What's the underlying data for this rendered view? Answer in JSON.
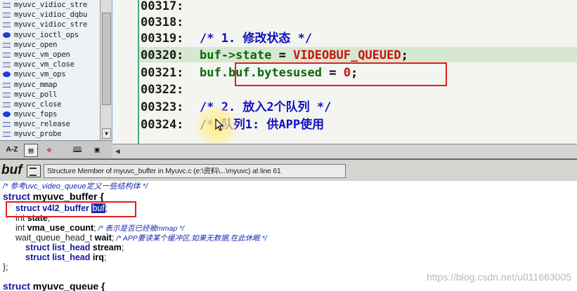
{
  "symbol_list": {
    "items": [
      {
        "label": "myuvc_vidioc_stre",
        "icon": "line"
      },
      {
        "label": "myuvc_vidioc_dqbu",
        "icon": "line"
      },
      {
        "label": "myuvc_vidioc_stre",
        "icon": "line"
      },
      {
        "label": "myuvc_ioctl_ops",
        "icon": "blob"
      },
      {
        "label": "myuvc_open",
        "icon": "line"
      },
      {
        "label": "myuvc_vm_open",
        "icon": "line"
      },
      {
        "label": "myuvc_vm_close",
        "icon": "line"
      },
      {
        "label": "myuvc_vm_ops",
        "icon": "blob"
      },
      {
        "label": "myuvc_mmap",
        "icon": "line"
      },
      {
        "label": "myuvc_poll",
        "icon": "line"
      },
      {
        "label": "myuvc_close",
        "icon": "line"
      },
      {
        "label": "myuvc_fops",
        "icon": "blob"
      },
      {
        "label": "myuvc_release",
        "icon": "line"
      },
      {
        "label": "myuvc_probe",
        "icon": "line"
      }
    ],
    "toolbar": {
      "az_label": "A-Z"
    }
  },
  "code_editor": {
    "lines": [
      {
        "num": "00317:",
        "code": []
      },
      {
        "num": "00318:",
        "code": []
      },
      {
        "num": "00319:",
        "code": [
          {
            "cls": "comment",
            "text": "/* 1. 修改状态 */"
          }
        ]
      },
      {
        "num": "00320:",
        "code": [
          {
            "cls": "var",
            "text": "buf->state"
          },
          {
            "cls": "op",
            "text": " = "
          },
          {
            "cls": "const",
            "text": "VIDEOBUF_QUEUED"
          },
          {
            "cls": "op",
            "text": ";"
          }
        ]
      },
      {
        "num": "00321:",
        "code": [
          {
            "cls": "var",
            "text": "buf.buf.bytesused"
          },
          {
            "cls": "op",
            "text": " = "
          },
          {
            "cls": "const",
            "text": "0"
          },
          {
            "cls": "op",
            "text": ";"
          }
        ]
      },
      {
        "num": "00322:",
        "code": []
      },
      {
        "num": "00323:",
        "code": [
          {
            "cls": "comment",
            "text": "/* 2. 放入2个队列 */"
          }
        ]
      },
      {
        "num": "00324:",
        "code": [
          {
            "cls": "comment",
            "text": "/* 队列1: 供APP使用"
          }
        ]
      }
    ]
  },
  "context_window": {
    "symbol": "buf",
    "description": "Structure Member of myuvc_buffer in Myuvc.c (e:\\资料\\...\\myuvc) at line 61",
    "comment_top": "/* 参考uvc_video_queue定义一些结构体 */",
    "struct_kw": "struct",
    "struct_name": "myuvc_buffer",
    "struct_open": " {",
    "member1_type": "struct v4l2_buffer ",
    "member1_name": "buf",
    "member1_end": ";",
    "member2_type": "int ",
    "member2_name": "state",
    "member2_end": ";",
    "member3_type": "int ",
    "member3_name": "vma_use_count",
    "member3_end": ";",
    "member3_comment": " /* 表示是否已经被mmap */",
    "member4_type": "wait_queue_head_t ",
    "member4_name": "wait",
    "member4_end": ";",
    "member4_comment": "  /* APP要读某个缓冲区,如果无数据,在此休眠 */",
    "member5_type": "struct list_head ",
    "member5_name": "stream",
    "member5_end": ";",
    "member6_type": "struct list_head ",
    "member6_name": "irq",
    "member6_end": ";",
    "close": "};",
    "next_struct_kw": "struct",
    "next_struct_name": "myuvc_queue",
    "next_open": " {"
  },
  "watermark": "https://blog.csdn.net/u011663005",
  "colors": {
    "accent_red": "#e02020",
    "comment_blue": "#1010c0",
    "var_green": "#0a6a0a",
    "const_red": "#cc1010"
  }
}
